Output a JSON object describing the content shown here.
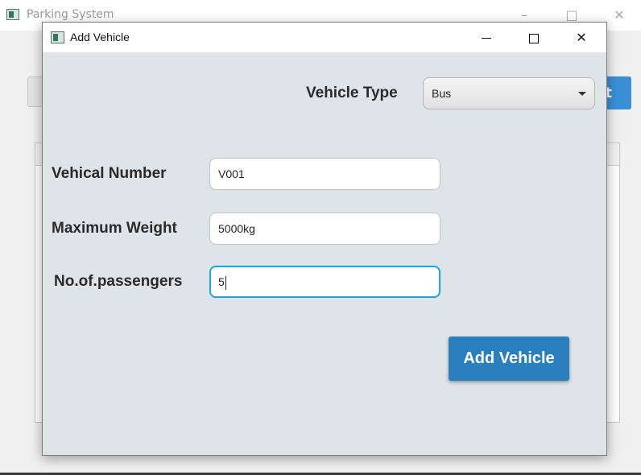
{
  "main_window": {
    "title": "Parking System",
    "right_button_label": "t"
  },
  "dialog": {
    "title": "Add Vehicle",
    "controls": {
      "minimize": "minimize",
      "maximize": "maximize",
      "close": "close"
    },
    "vehicle_type": {
      "label": "Vehicle Type",
      "selected": "Bus"
    },
    "vehicle_number": {
      "label": "Vehical Number",
      "value": "V001"
    },
    "maximum_weight": {
      "label": "Maximum Weight",
      "value": "5000kg"
    },
    "passengers": {
      "label": "No.of.passengers",
      "value": "5"
    },
    "submit_label": "Add Vehicle"
  },
  "colors": {
    "accent": "#2a7fbf",
    "focus": "#2aa3d2",
    "dialog_bg": "#dfe4e8"
  },
  "icons": [
    "app-window-icon",
    "minimize-icon",
    "maximize-icon",
    "close-icon",
    "chevron-down-icon"
  ]
}
